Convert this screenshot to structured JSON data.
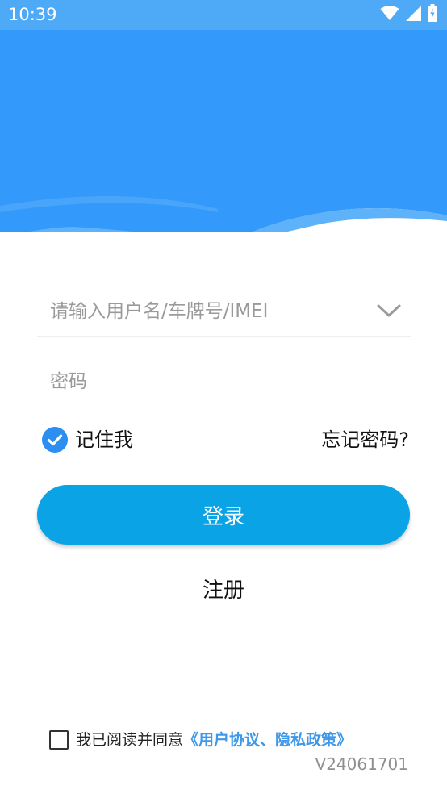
{
  "status_bar": {
    "time": "10:39",
    "icons": [
      "wifi-icon",
      "cell-signal-icon",
      "battery-icon"
    ],
    "background": "#4ea9f6"
  },
  "header": {
    "colors": {
      "primary": "#3399fb",
      "wave_light": "#5eb2fa"
    }
  },
  "login_form": {
    "username_placeholder": "请输入用户名/车牌号/IMEI",
    "password_placeholder": "密码",
    "remember_me": {
      "label": "记住我",
      "checked": true
    },
    "forgot_password": "忘记密码?",
    "login_button": "登录",
    "register": "注册"
  },
  "agreement": {
    "checked": false,
    "text": "我已阅读并同意",
    "link": "《用户协议、隐私政策》"
  },
  "version": "V24061701",
  "colors": {
    "accent": "#0aa3e6",
    "check_blue": "#2b8ef0",
    "link_blue": "#3e97e8"
  }
}
